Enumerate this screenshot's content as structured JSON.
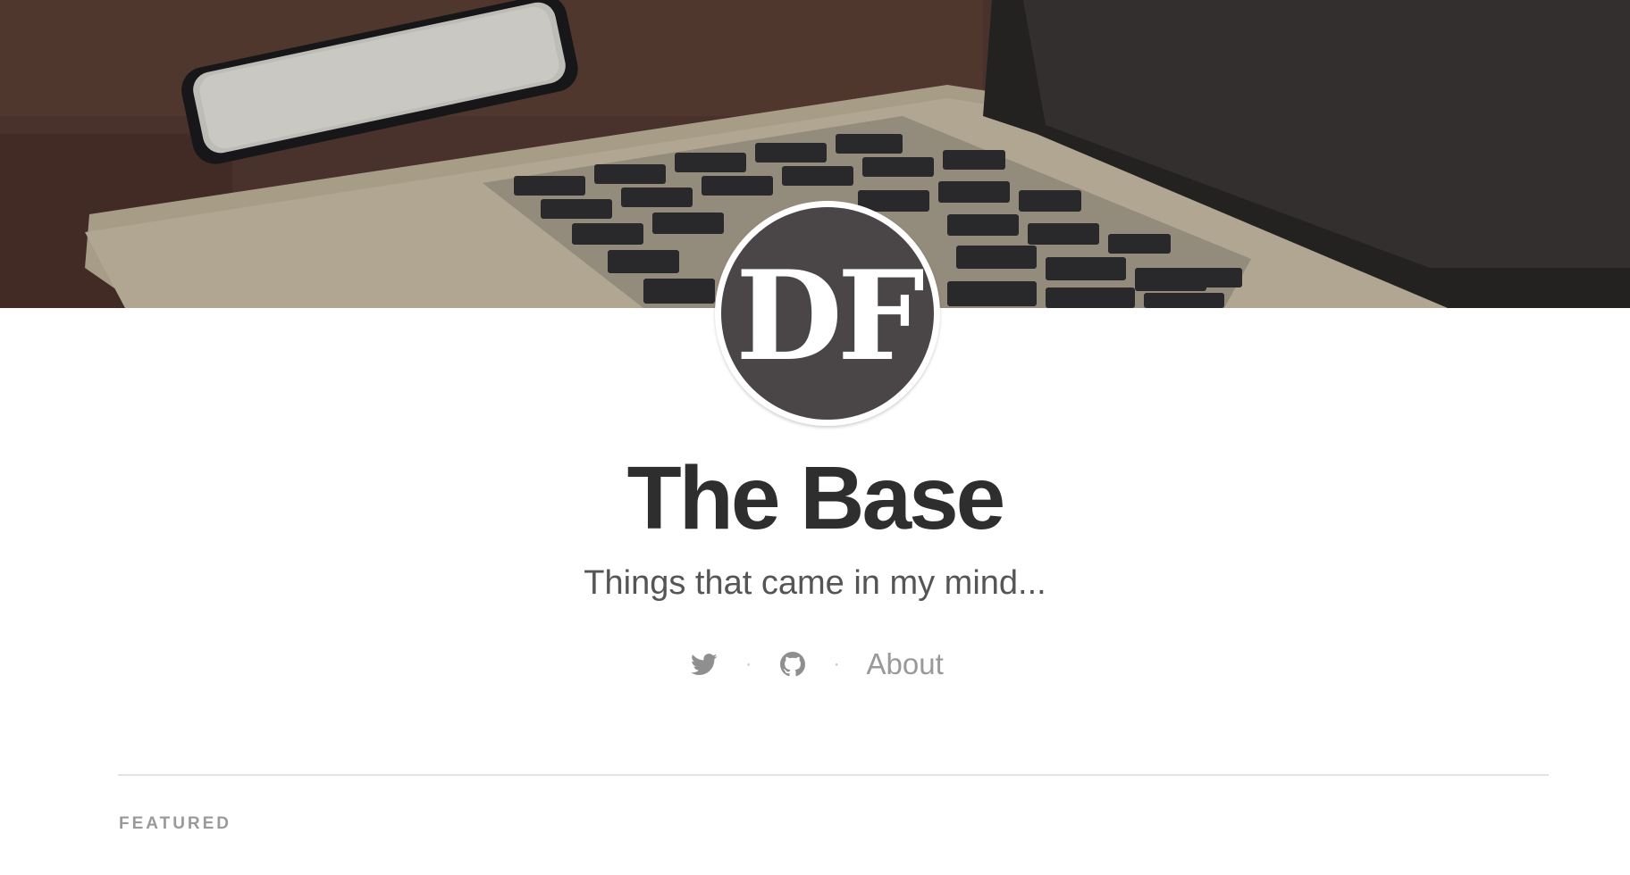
{
  "blog": {
    "avatar_initials": "DF",
    "title": "The Base",
    "description": "Things that came in my mind..."
  },
  "nav": {
    "twitter_icon": "twitter-icon",
    "github_icon": "github-icon",
    "separator": "·",
    "about_label": "About"
  },
  "section": {
    "featured_label": "FEATURED"
  },
  "colors": {
    "avatar_bg": "#4a4648",
    "title": "#2e2e2e",
    "description": "#555555",
    "nav": "#999999"
  }
}
